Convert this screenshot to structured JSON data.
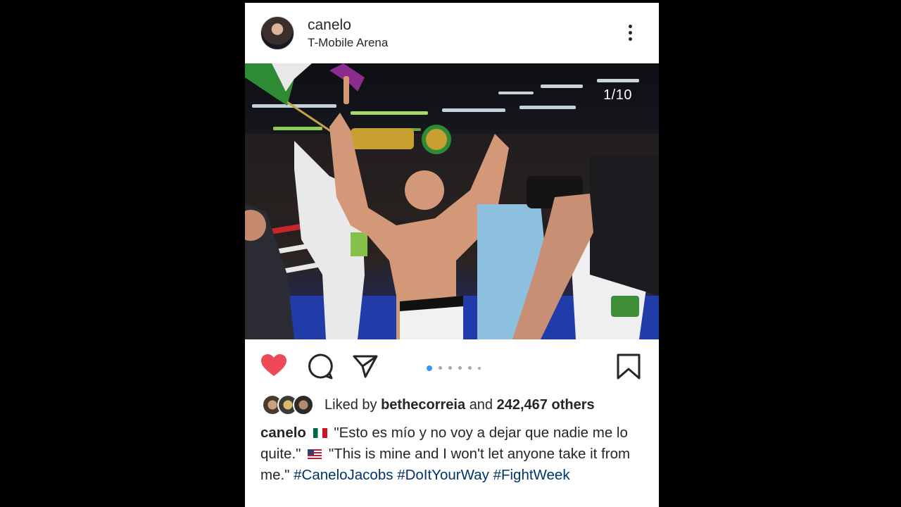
{
  "post": {
    "username": "canelo",
    "location": "T-Mobile Arena",
    "carousel": {
      "current": 1,
      "total": 10,
      "label": "1/10"
    },
    "likes": {
      "prefix": "Liked by",
      "user": "bethecorreia",
      "conj": "and",
      "count_text": "242,467 others"
    },
    "caption": {
      "author": "canelo",
      "spanish_quote": "\"Esto es mío y no voy a dejar que nadie me lo quite.\"",
      "english_quote": "\"This is mine and I won't let anyone take it from me.\"",
      "hashtags": [
        "#CaneloJacobs",
        "#DoItYourWay",
        "#FightWeek"
      ]
    }
  },
  "icons": {
    "more": "more-vertical-icon",
    "like": "heart-icon",
    "comment": "comment-icon",
    "share": "paper-plane-icon",
    "save": "bookmark-icon"
  },
  "colors": {
    "like": "#ed4956",
    "hashtag": "#003569",
    "active_dot": "#3897f0"
  }
}
